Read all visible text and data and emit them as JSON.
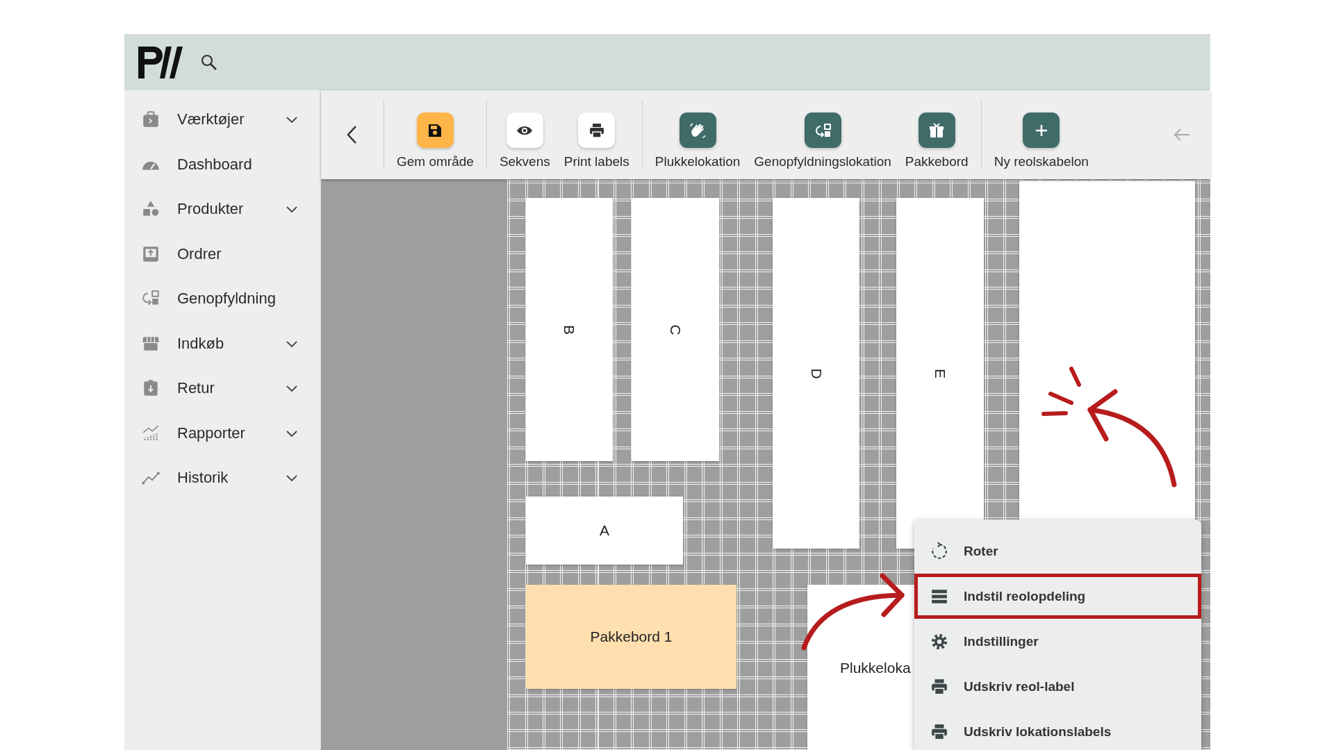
{
  "sidebar": {
    "items": [
      {
        "label": "Værktøjer",
        "has_submenu": true
      },
      {
        "label": "Dashboard",
        "has_submenu": false
      },
      {
        "label": "Produkter",
        "has_submenu": true
      },
      {
        "label": "Ordrer",
        "has_submenu": false
      },
      {
        "label": "Genopfyldning",
        "has_submenu": false
      },
      {
        "label": "Indkøb",
        "has_submenu": true
      },
      {
        "label": "Retur",
        "has_submenu": true
      },
      {
        "label": "Rapporter",
        "has_submenu": true
      },
      {
        "label": "Historik",
        "has_submenu": true
      }
    ]
  },
  "toolbar": {
    "groups": [
      [
        {
          "label": "Gem område"
        }
      ],
      [
        {
          "label": "Sekvens"
        },
        {
          "label": "Print labels"
        }
      ],
      [
        {
          "label": "Plukkelokation"
        },
        {
          "label": "Genopfyldningslokation"
        },
        {
          "label": "Pakkebord"
        }
      ],
      [
        {
          "label": "Ny reolskabelon"
        }
      ]
    ]
  },
  "canvas": {
    "objects": [
      {
        "kind": "shelf",
        "label": "B",
        "rotated": true
      },
      {
        "kind": "shelf",
        "label": "C",
        "rotated": true
      },
      {
        "kind": "shelf",
        "label": "D",
        "rotated": true
      },
      {
        "kind": "shelf",
        "label": "E",
        "rotated": true
      },
      {
        "kind": "shelf"
      },
      {
        "kind": "shelf",
        "label": "A",
        "rotated": false
      },
      {
        "kind": "packing_table",
        "label": "Pakkebord 1",
        "rotated": false
      },
      {
        "kind": "location",
        "label": "Plukkeloka",
        "rotated": false
      }
    ]
  },
  "context_menu": {
    "items": [
      {
        "label": "Roter",
        "highlighted": false
      },
      {
        "label": "Indstil reolopdeling",
        "highlighted": true
      },
      {
        "label": "Indstillinger",
        "highlighted": false
      },
      {
        "label": "Udskriv reol-label",
        "highlighted": false
      },
      {
        "label": "Udskriv lokationslabels",
        "highlighted": false
      }
    ]
  }
}
